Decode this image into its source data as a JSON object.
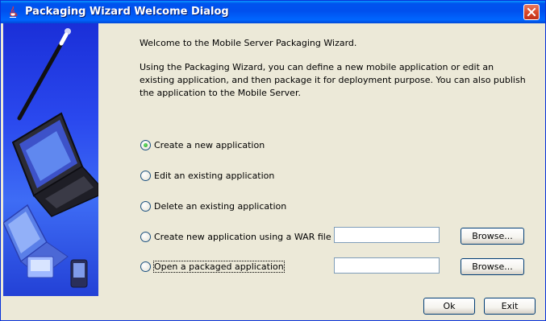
{
  "window": {
    "title": "Packaging Wizard Welcome Dialog"
  },
  "intro": {
    "welcome": "Welcome to the Mobile Server Packaging Wizard.",
    "description": "Using the Packaging Wizard, you can define a new mobile application or edit an existing application, and then package it for deployment purpose.  You can also publish the application to the Mobile Server."
  },
  "options": [
    {
      "label": "Create a new application",
      "checked": true
    },
    {
      "label": "Edit an existing application",
      "checked": false
    },
    {
      "label": "Delete an existing application",
      "checked": false
    },
    {
      "label": "Create new application using a WAR file",
      "checked": false,
      "field_value": "",
      "browse_label": "Browse..."
    },
    {
      "label": "Open a packaged application",
      "checked": false,
      "field_value": "",
      "browse_label": "Browse..."
    }
  ],
  "footer": {
    "ok_label": "Ok",
    "exit_label": "Exit"
  },
  "icons": {
    "title": "java-cup-icon",
    "close": "close-icon",
    "side": "wizard-laptop-illustration"
  },
  "colors": {
    "titlebar": "#0054e3",
    "dialog_background": "#ece9d8",
    "side_panel": "#2a48ee",
    "radio_selected": "#21a121"
  }
}
